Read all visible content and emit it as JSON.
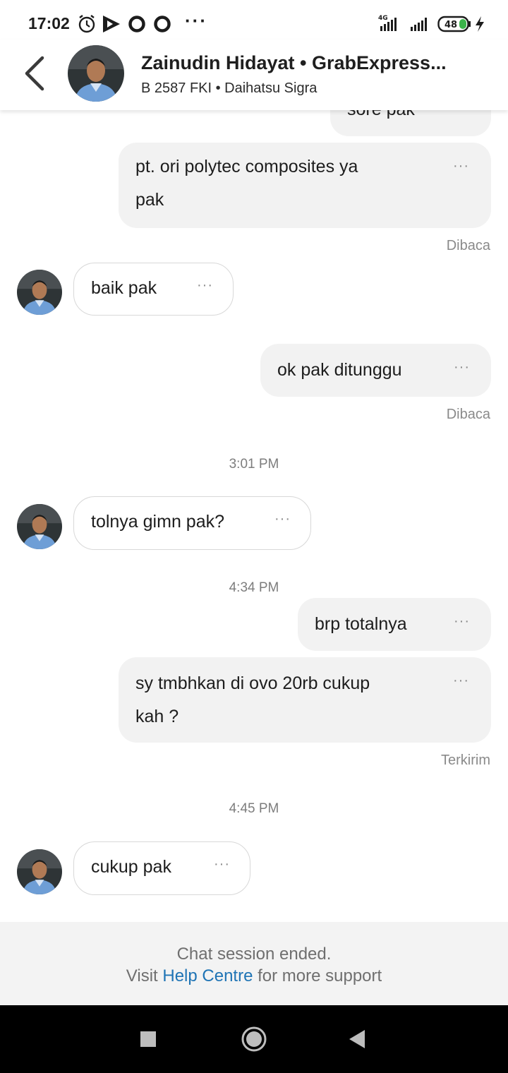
{
  "status_bar": {
    "time": "17:02",
    "icons": [
      "alarm-icon",
      "play-store-icon",
      "circle-icon",
      "circle-icon",
      "more-dots-icon"
    ],
    "more_dots": "···",
    "network_label": "4G",
    "battery": "48",
    "charging": true
  },
  "header": {
    "back_icon": "chevron-left-icon",
    "driver_name": "Zainudin Hidayat • GrabExpress...",
    "vehicle_info": "B 2587 FKI • Daihatsu Sigra"
  },
  "messages": [
    {
      "side": "out",
      "lines": [
        "sore pak"
      ]
    },
    {
      "side": "out",
      "lines": [
        "pt. ori polytec composites ya",
        "pak"
      ],
      "receipt": "Dibaca"
    },
    {
      "side": "in",
      "lines": [
        "baik pak"
      ]
    },
    {
      "side": "out",
      "lines": [
        "ok pak ditunggu"
      ],
      "receipt": "Dibaca"
    },
    {
      "separator": "3:01 PM"
    },
    {
      "side": "in",
      "lines": [
        "tolnya gimn pak?"
      ]
    },
    {
      "separator": "4:34 PM"
    },
    {
      "side": "out",
      "lines": [
        "brp totalnya"
      ]
    },
    {
      "side": "out",
      "lines": [
        "sy tmbhkan di ovo 20rb cukup",
        "kah ?"
      ],
      "receipt": "Terkirim"
    },
    {
      "separator": "4:45 PM"
    },
    {
      "side": "in",
      "lines": [
        "cukup pak"
      ]
    }
  ],
  "more_label": "···",
  "footer": {
    "line1": "Chat session ended.",
    "line2_prefix": "Visit",
    "link": "Help Centre",
    "line2_suffix": "for more support"
  },
  "nav_bar": {
    "buttons": [
      "recents-square-icon",
      "home-circle-icon",
      "back-triangle-icon"
    ]
  },
  "colors": {
    "link": "#1f74b5",
    "outgoing_bubble": "#f2f2f2",
    "incoming_border": "#d8d8d8"
  }
}
